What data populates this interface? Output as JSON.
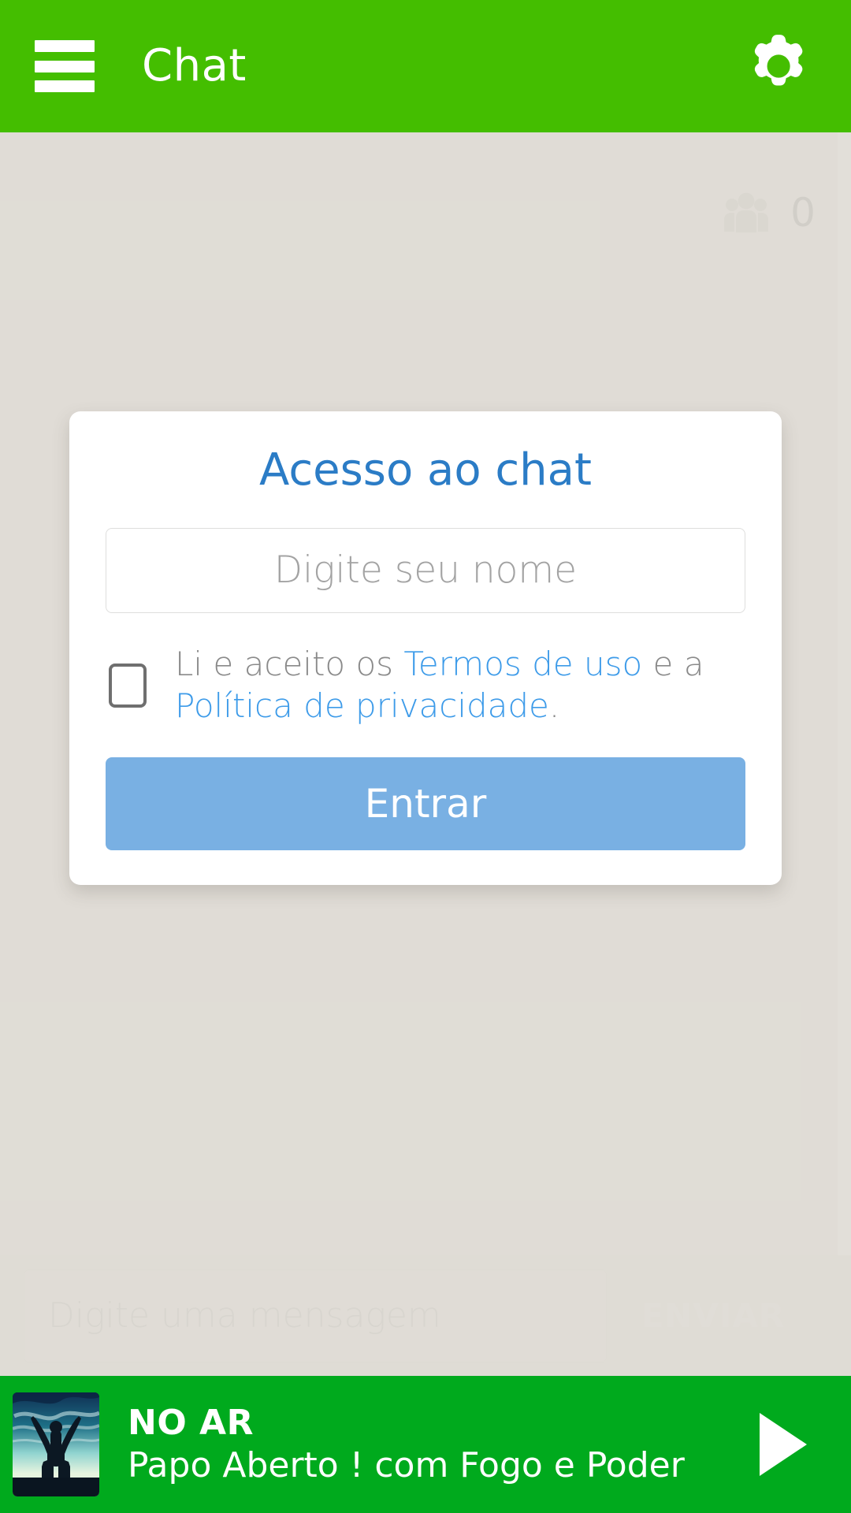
{
  "header": {
    "menu_icon": "hamburger-menu-icon",
    "title": "Chat",
    "settings_icon": "gear-icon",
    "background_color": "#44be00"
  },
  "chat": {
    "user_counter": {
      "icon": "users-group-icon",
      "count": "0"
    },
    "composer": {
      "placeholder": "Digite uma mensagem",
      "send_label": "ENVIAR"
    }
  },
  "login_modal": {
    "title": "Acesso ao chat",
    "title_color": "#2b7cc6",
    "name_input": {
      "value": "",
      "placeholder": "Digite seu nome"
    },
    "terms": {
      "checked": false,
      "prefix": "Li e aceito os ",
      "link_terms": "Termos de uso",
      "middle": " e a ",
      "link_privacy": "Política de privacidade",
      "suffix": ".",
      "link_color": "#3d9be9"
    },
    "submit_label": "Entrar",
    "submit_color": "#79b0e3"
  },
  "player": {
    "thumbnail_icon": "person-arms-raised-sky-thumbnail",
    "status": "NO AR",
    "program": "Papo Aberto ! com Fogo e Poder",
    "play_icon": "play-triangle-icon",
    "background_color": "#00aa1d"
  }
}
